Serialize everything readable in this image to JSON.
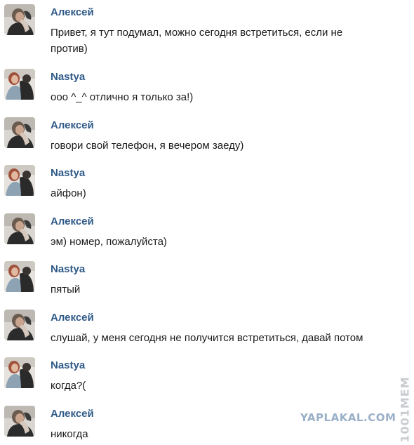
{
  "messages": [
    {
      "author": "Алексей",
      "text": "Привет, я тут подумал, можно сегодня встретиться, если не против)",
      "avatar": "man-avatar"
    },
    {
      "author": "Nastya",
      "text": "ооо ^_^ отлично я только за!)",
      "avatar": "woman-avatar"
    },
    {
      "author": "Алексей",
      "text": "говори свой телефон, я вечером заеду)",
      "avatar": "man-avatar"
    },
    {
      "author": "Nastya",
      "text": "айфон)",
      "avatar": "woman-avatar"
    },
    {
      "author": "Алексей",
      "text": "эм) номер, пожалуйста)",
      "avatar": "man-avatar"
    },
    {
      "author": "Nastya",
      "text": "пятый",
      "avatar": "woman-avatar"
    },
    {
      "author": "Алексей",
      "text": "слушай, у меня сегодня не получится встретиться, давай потом",
      "avatar": "man-avatar"
    },
    {
      "author": "Nastya",
      "text": "когда?(",
      "avatar": "woman-avatar"
    },
    {
      "author": "Алексей",
      "text": "никогда",
      "avatar": "man-avatar"
    }
  ],
  "watermarks": {
    "site": "YAPLAKAL.COM",
    "side": "1001MEM"
  },
  "colors": {
    "author": "#2f5a88",
    "text": "#1a1a1a"
  }
}
